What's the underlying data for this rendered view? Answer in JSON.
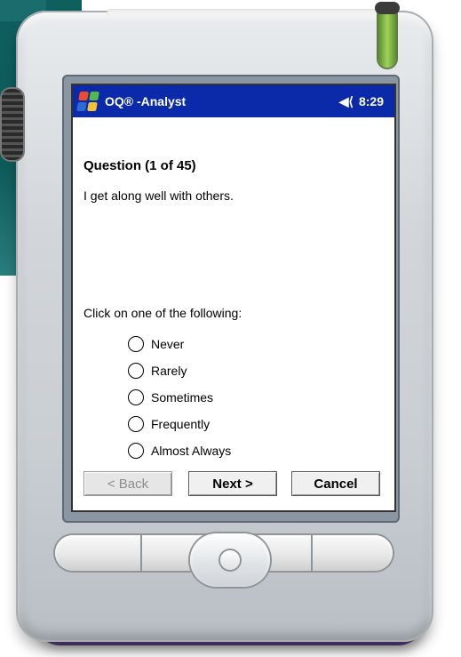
{
  "device": {
    "title_bar": {
      "app_title": "OQ® -Analyst",
      "sound_icon": "speaker-icon",
      "time": "8:29"
    },
    "question": {
      "heading": "Question (1 of 45)",
      "text": "I get along well with others.",
      "instructions": "Click on one of the following:"
    },
    "options": [
      {
        "label": "Never"
      },
      {
        "label": "Rarely"
      },
      {
        "label": "Sometimes"
      },
      {
        "label": "Frequently"
      },
      {
        "label": "Almost Always"
      }
    ],
    "buttons": {
      "back_label": "< Back",
      "next_label": "Next >",
      "cancel_label": "Cancel"
    },
    "colors": {
      "title_bar": "#0b2aa9",
      "screen": "#ffffff",
      "device_purple": "#6a4e94",
      "stylus_green": "#9fd25c"
    }
  }
}
